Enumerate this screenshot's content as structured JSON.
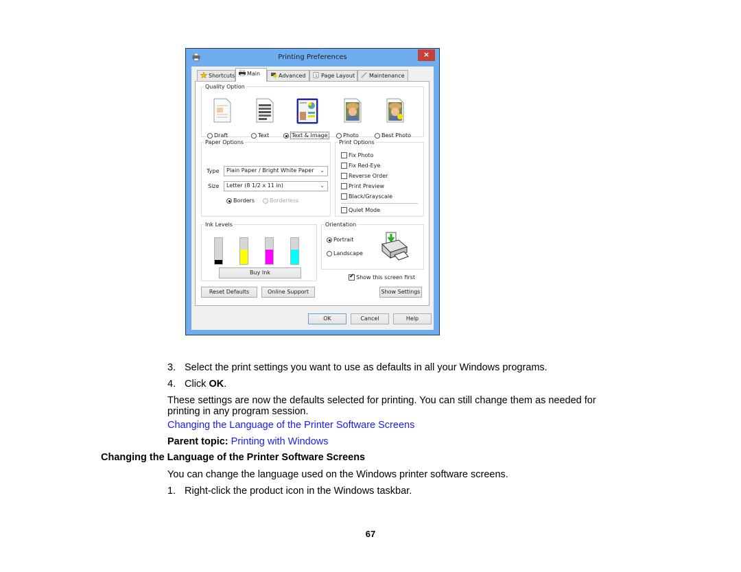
{
  "dialog": {
    "title": "Printing Preferences",
    "close_label": "×",
    "tabs": [
      {
        "label": "Shortcuts",
        "icon": "star-icon"
      },
      {
        "label": "Main",
        "icon": "printer-icon",
        "active": true
      },
      {
        "label": "Advanced",
        "icon": "advanced-settings-icon"
      },
      {
        "label": "Page Layout",
        "icon": "page-layout-icon"
      },
      {
        "label": "Maintenance",
        "icon": "wrench-icon"
      }
    ],
    "quality_option": {
      "legend": "Quality Option",
      "options": [
        {
          "label": "Draft",
          "selected": false
        },
        {
          "label": "Text",
          "selected": false
        },
        {
          "label": "Text & Image",
          "selected": true
        },
        {
          "label": "Photo",
          "selected": false
        },
        {
          "label": "Best Photo",
          "selected": false
        }
      ]
    },
    "paper_options": {
      "legend": "Paper Options",
      "type_label": "Type",
      "type_value": "Plain Paper / Bright White Paper",
      "size_label": "Size",
      "size_value": "Letter (8 1/2 x 11 in)",
      "borders_label": "Borders",
      "borderless_label": "Borderless",
      "borders_selected": true
    },
    "print_options": {
      "legend": "Print Options",
      "items": [
        {
          "label": "Fix Photo",
          "checked": false
        },
        {
          "label": "Fix Red-Eye",
          "checked": false
        },
        {
          "label": "Reverse Order",
          "checked": false
        },
        {
          "label": "Print Preview",
          "checked": false
        },
        {
          "label": "Black/Grayscale",
          "checked": false
        }
      ],
      "quiet_mode": {
        "label": "Quiet Mode",
        "checked": false
      }
    },
    "ink_levels": {
      "legend": "Ink Levels",
      "inks": [
        {
          "name": "Black",
          "color": "#000000",
          "level_pct": 15
        },
        {
          "name": "Yellow",
          "color": "#ffff00",
          "level_pct": 55
        },
        {
          "name": "Magenta",
          "color": "#ff00ff",
          "level_pct": 55
        },
        {
          "name": "Cyan",
          "color": "#00ffff",
          "level_pct": 55
        }
      ],
      "buy_ink_label": "Buy Ink"
    },
    "orientation": {
      "legend": "Orientation",
      "portrait_label": "Portrait",
      "landscape_label": "Landscape",
      "selected": "Portrait"
    },
    "show_screen_first": {
      "label": "Show this screen first",
      "checked": true
    },
    "buttons": {
      "reset_defaults": "Reset Defaults",
      "online_support": "Online Support",
      "show_settings": "Show Settings",
      "ok": "OK",
      "cancel": "Cancel",
      "help": "Help"
    }
  },
  "document": {
    "step3_num": "3.",
    "step3_text": "Select the print settings you want to use as defaults in all your Windows programs.",
    "step4_num": "4.",
    "step4_prefix": "Click ",
    "step4_bold": "OK",
    "step4_suffix": ".",
    "para_line1": "These settings are now the defaults selected for printing. You can still change them as needed for",
    "para_line2": "printing in any program session.",
    "related_link": "Changing the Language of the Printer Software Screens",
    "parent_topic_label": "Parent topic:",
    "parent_topic_link": "Printing with Windows",
    "section_heading": "Changing the Language of the Printer Software Screens",
    "section_intro": "You can change the language used on the Windows printer software screens.",
    "step1_num": "1.",
    "step1_text": "Right-click the product icon in the Windows taskbar.",
    "page_number": "67"
  }
}
